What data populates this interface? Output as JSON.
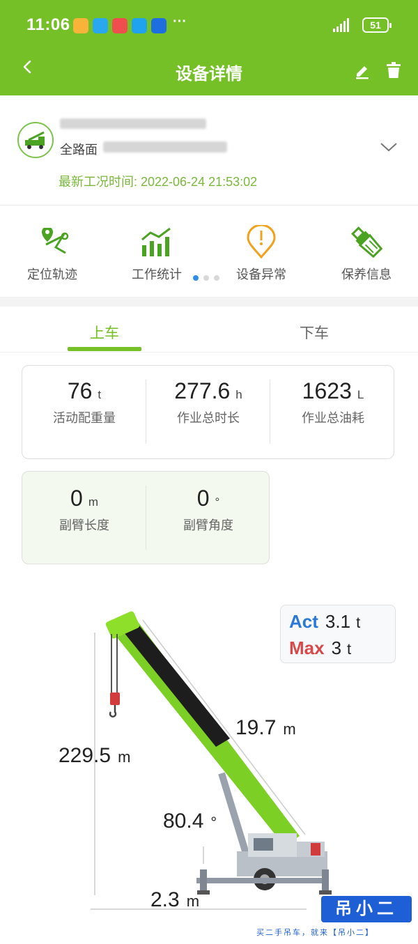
{
  "status_bar": {
    "time": "11:06",
    "more": "···",
    "battery": "51"
  },
  "header": {
    "title": "设备详情",
    "icons": [
      "back-icon",
      "edit-icon",
      "delete-icon"
    ]
  },
  "device": {
    "owner_prefix": "全路面",
    "update_label": "最新工况时间: 2022-06-24 21:53:02"
  },
  "quick_menu": [
    {
      "label": "定位轨迹",
      "icon": "location-track-icon"
    },
    {
      "label": "工作统计",
      "icon": "work-stats-icon"
    },
    {
      "label": "设备异常",
      "icon": "device-alert-icon"
    },
    {
      "label": "保养信息",
      "icon": "maintenance-icon"
    }
  ],
  "tabs": [
    {
      "label": "上车"
    },
    {
      "label": "下车"
    }
  ],
  "stats_main": [
    {
      "value": "76",
      "unit": "t",
      "label": "活动配重量"
    },
    {
      "value": "277.6",
      "unit": "h",
      "label": "作业总时长"
    },
    {
      "value": "1623",
      "unit": "L",
      "label": "作业总油耗"
    }
  ],
  "stats_aux": [
    {
      "value": "0",
      "unit": "m",
      "label": "副臂长度"
    },
    {
      "value": "0",
      "unit": "°",
      "label": "副臂角度"
    }
  ],
  "load": {
    "act_key": "Act",
    "act_value": "3.1",
    "act_unit": "t",
    "max_key": "Max",
    "max_value": "3",
    "max_unit": "t"
  },
  "crane": {
    "height_value": "229.5",
    "height_unit": "m",
    "boom_value": "19.7",
    "boom_unit": "m",
    "angle_value": "80.4",
    "angle_unit": "°",
    "radius_value": "2.3",
    "radius_unit": "m"
  },
  "watermark": {
    "brand": "吊小二",
    "slogan": "买二手吊车，就来【吊小二】"
  },
  "colors": {
    "brand_green": "#74c026",
    "act_blue": "#2b78d6",
    "max_red": "#d84a4a"
  }
}
